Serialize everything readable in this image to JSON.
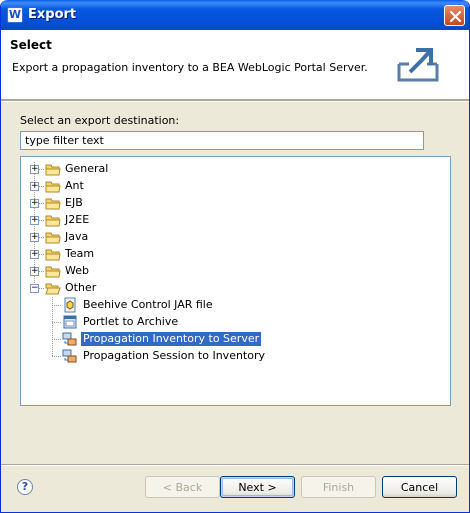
{
  "window": {
    "title": "Export"
  },
  "header": {
    "title": "Select",
    "description": "Export a propagation inventory to a BEA WebLogic Portal Server."
  },
  "destination": {
    "label": "Select an export destination:",
    "filter_value": "type filter text"
  },
  "tree": {
    "categories": [
      {
        "label": "General",
        "expanded": false
      },
      {
        "label": "Ant",
        "expanded": false
      },
      {
        "label": "EJB",
        "expanded": false
      },
      {
        "label": "J2EE",
        "expanded": false
      },
      {
        "label": "Java",
        "expanded": false
      },
      {
        "label": "Team",
        "expanded": false
      },
      {
        "label": "Web",
        "expanded": false
      },
      {
        "label": "Other",
        "expanded": true
      }
    ],
    "other_items": [
      {
        "label": "Beehive Control JAR file",
        "icon": "beehive-jar-icon",
        "selected": false
      },
      {
        "label": "Portlet to Archive",
        "icon": "portlet-icon",
        "selected": false
      },
      {
        "label": "Propagation Inventory to Server",
        "icon": "propagation-icon",
        "selected": true
      },
      {
        "label": "Propagation Session to Inventory",
        "icon": "propagation-icon",
        "selected": false
      }
    ]
  },
  "buttons": {
    "back": "< Back",
    "next": "Next >",
    "finish": "Finish",
    "cancel": "Cancel"
  },
  "colors": {
    "selection": "#316ac5",
    "folder": "#f5d36b",
    "titlebar": "#0858e0"
  }
}
